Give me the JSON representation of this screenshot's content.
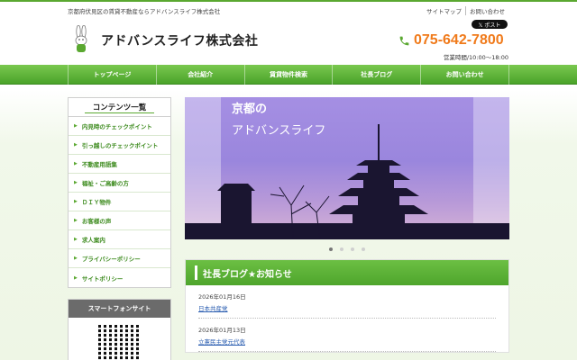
{
  "header": {
    "tagline": "京都府伏見区の賃貸不動産ならアドバンスライフ株式会社",
    "top_links": [
      "サイトマップ",
      "お問い合わせ"
    ],
    "x_post": "𝕏 ポスト",
    "company": "アドバンスライフ株式会社",
    "phone": "075-642-7800",
    "hours": "営業時間/10:00～18:00"
  },
  "nav": [
    "トップページ",
    "会社紹介",
    "賃貸物件検索",
    "社長ブログ",
    "お問い合わせ"
  ],
  "sidebar": {
    "title": "コンテンツ一覧",
    "items": [
      "内見時のチェックポイント",
      "引っ越しのチェックポイント",
      "不動産用語集",
      "福祉・ご高齢の方",
      "ＤＩＹ物件",
      "お客様の声",
      "求人案内",
      "プライバシーポリシー",
      "サイトポリシー"
    ],
    "smartphone_title": "スマートフォンサイト"
  },
  "slider": {
    "line1": "京都の",
    "line2": "アドバンスライフ",
    "dots": 4,
    "active_dot": 0
  },
  "blog": {
    "title": "社長ブログ★お知らせ",
    "posts": [
      {
        "date": "2026年01月16日",
        "title": "日本共産党"
      },
      {
        "date": "2026年01月13日",
        "title": "立憲民主党元代表"
      }
    ]
  },
  "colors": {
    "brand_green": "#5aa830",
    "phone_orange": "#f07a1a"
  }
}
